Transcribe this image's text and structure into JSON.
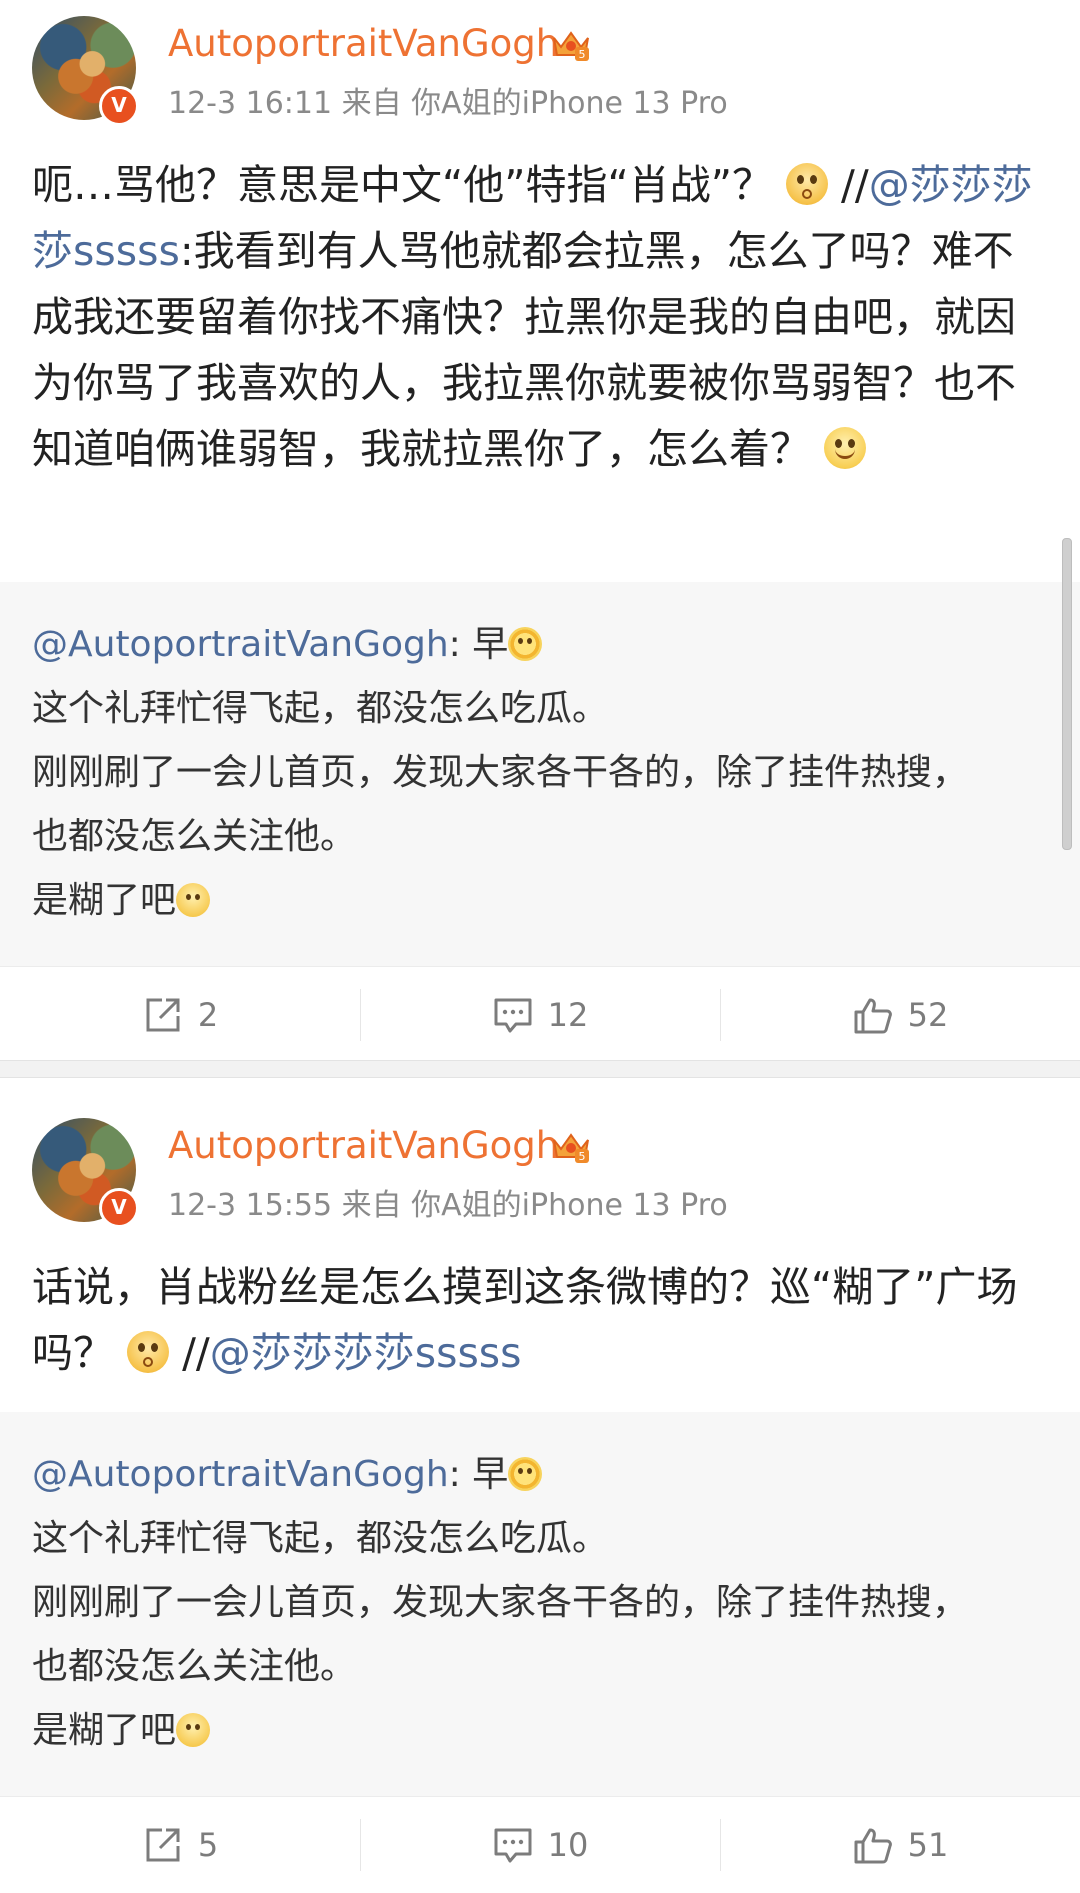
{
  "posts": [
    {
      "username": "AutoportraitVanGogh",
      "meta": "12-3 16:11 来自 你A姐的iPhone 13 Pro",
      "body_a": "呃…骂他？意思是中文“他”特指“肖战”？",
      "body_sep": " //",
      "body_mention": "@莎莎莎莎sssss",
      "body_b": ":我看到有人骂他就都会拉黑，怎么了吗？难不成我还要留着你找不痛快？拉黑你是我的自由吧，就因为你骂了我喜欢的人，我拉黑你就要被你骂弱智？也不知道咱俩谁弱智，我就拉黑你了，怎么着？",
      "quote": {
        "mention": "@AutoportraitVanGogh",
        "head": ": 早",
        "line1": "这个礼拜忙得飞起，都没怎么吃瓜。",
        "line2": "刚刚刷了一会儿首页，发现大家各干各的，除了挂件热搜，",
        "line3": "也都没怎么关注他。",
        "line4": "是糊了吧"
      },
      "reposts": "2",
      "comments": "12",
      "likes": "52"
    },
    {
      "username": "AutoportraitVanGogh",
      "meta": "12-3 15:55 来自 你A姐的iPhone 13 Pro",
      "body_a": "话说，肖战粉丝是怎么摸到这条微博的？巡“糊了”广场吗？",
      "body_sep": " //",
      "body_mention": "@莎莎莎莎sssss",
      "quote": {
        "mention": "@AutoportraitVanGogh",
        "head": ": 早",
        "line1": "这个礼拜忙得飞起，都没怎么吃瓜。",
        "line2": "刚刚刷了一会儿首页，发现大家各干各的，除了挂件热搜，",
        "line3": "也都没怎么关注他。",
        "line4": "是糊了吧"
      },
      "reposts": "5",
      "comments": "10",
      "likes": "51"
    }
  ],
  "badge": {
    "verified": "V",
    "level": "5"
  },
  "colors": {
    "username": "#ee7233",
    "link": "#4d6b9a",
    "meta": "#8a8a8a",
    "quote_bg": "#f7f7f7"
  },
  "icons": [
    "repost-icon",
    "comment-icon",
    "like-icon",
    "crown-icon",
    "verified-badge-icon",
    "wow-emoji-icon",
    "smile-emoji-icon",
    "sun-emoji-icon",
    "thinking-emoji-icon"
  ]
}
